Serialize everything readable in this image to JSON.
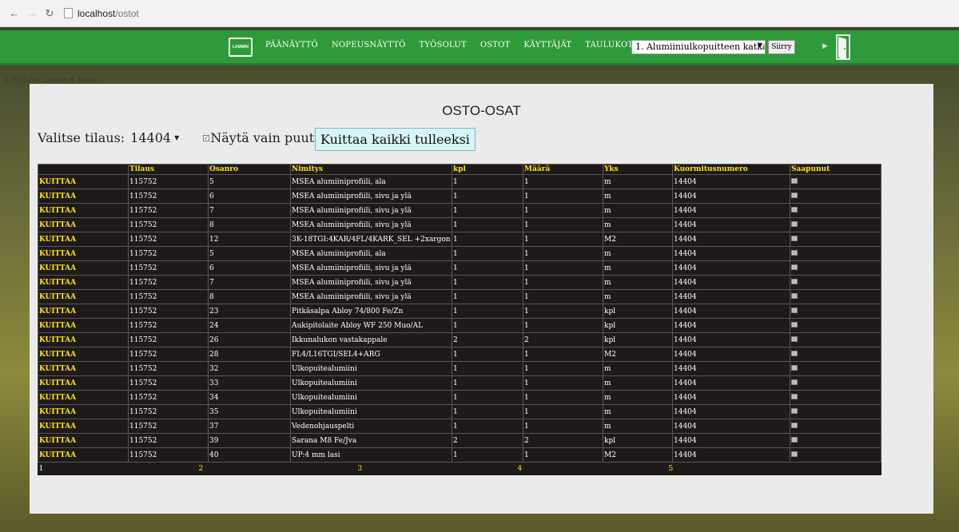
{
  "browser": {
    "url_host": "localhost",
    "url_path": "/ostot"
  },
  "nav": {
    "logo_text": "LAMMIN",
    "links": [
      "PÄÄNÄYTTÖ",
      "NOPEUSNÄYTTÖ",
      "TYÖSOLUT",
      "OSTOT",
      "KÄYTTÄJÄT",
      "TAULUKOT"
    ],
    "order_select_value": "1. Alumiiniulkopuitteen katka",
    "go_label": "Siirry"
  },
  "copyright": "© 2016 Eeli Laitinen & Tommi",
  "page": {
    "title": "OSTO-OSAT",
    "order_label": "Valitse tilaus:",
    "order_value": "14404",
    "missing_only_label": "Näytä vain puuttuvat",
    "ack_all_label": "Kuittaa kaikki tulleeksi"
  },
  "table": {
    "headers": [
      "",
      "Tilaus",
      "Osanro",
      "Nimitys",
      "kpl",
      "Määrä",
      "Yks",
      "Kuormitusnumero",
      "Saapunut"
    ],
    "ack_label": "KUITTAA",
    "rows": [
      [
        "115752",
        "5",
        "MSEA alumiiniprofiili, ala",
        "1",
        "1",
        "m",
        "14404"
      ],
      [
        "115752",
        "6",
        "MSEA alumiiniprofiili, sivu ja ylä",
        "1",
        "1",
        "m",
        "14404"
      ],
      [
        "115752",
        "7",
        "MSEA alumiiniprofiili, sivu ja ylä",
        "1",
        "1",
        "m",
        "14404"
      ],
      [
        "115752",
        "8",
        "MSEA alumiiniprofiili, sivu ja ylä",
        "1",
        "1",
        "m",
        "14404"
      ],
      [
        "115752",
        "12",
        "3K-18TGI:4KAR/4FL/4KARK_SEL +2xargon",
        "1",
        "1",
        "M2",
        "14404"
      ],
      [
        "115752",
        "5",
        "MSEA alumiiniprofiili, ala",
        "1",
        "1",
        "m",
        "14404"
      ],
      [
        "115752",
        "6",
        "MSEA alumiiniprofiili, sivu ja ylä",
        "1",
        "1",
        "m",
        "14404"
      ],
      [
        "115752",
        "7",
        "MSEA alumiiniprofiili, sivu ja ylä",
        "1",
        "1",
        "m",
        "14404"
      ],
      [
        "115752",
        "8",
        "MSEA alumiiniprofiili, sivu ja ylä",
        "1",
        "1",
        "m",
        "14404"
      ],
      [
        "115752",
        "23",
        "Pitkäsalpa Abloy 74/800 Fe/Zn",
        "1",
        "1",
        "kpl",
        "14404"
      ],
      [
        "115752",
        "24",
        "Aukipitolaite Abloy WF 250 Muo/AL",
        "1",
        "1",
        "kpl",
        "14404"
      ],
      [
        "115752",
        "26",
        "Ikkunalukon vastakappale",
        "2",
        "2",
        "kpl",
        "14404"
      ],
      [
        "115752",
        "28",
        "FL4/L16TGI/SEL4+ARG",
        "1",
        "1",
        "M2",
        "14404"
      ],
      [
        "115752",
        "32",
        "Ulkopuitealumiini",
        "1",
        "1",
        "m",
        "14404"
      ],
      [
        "115752",
        "33",
        "Ulkopuitealumiini",
        "1",
        "1",
        "m",
        "14404"
      ],
      [
        "115752",
        "34",
        "Ulkopuitealumiini",
        "1",
        "1",
        "m",
        "14404"
      ],
      [
        "115752",
        "35",
        "Ulkopuitealumiini",
        "1",
        "1",
        "m",
        "14404"
      ],
      [
        "115752",
        "37",
        "Vedenohjauspelti",
        "1",
        "1",
        "m",
        "14404"
      ],
      [
        "115752",
        "39",
        "Sarana M8 Fe/Jva",
        "2",
        "2",
        "kpl",
        "14404"
      ],
      [
        "115752",
        "40",
        "UP:4 mm lasi",
        "1",
        "1",
        "M2",
        "14404"
      ]
    ],
    "pages": [
      "1",
      "2",
      "3",
      "4",
      "5"
    ]
  }
}
